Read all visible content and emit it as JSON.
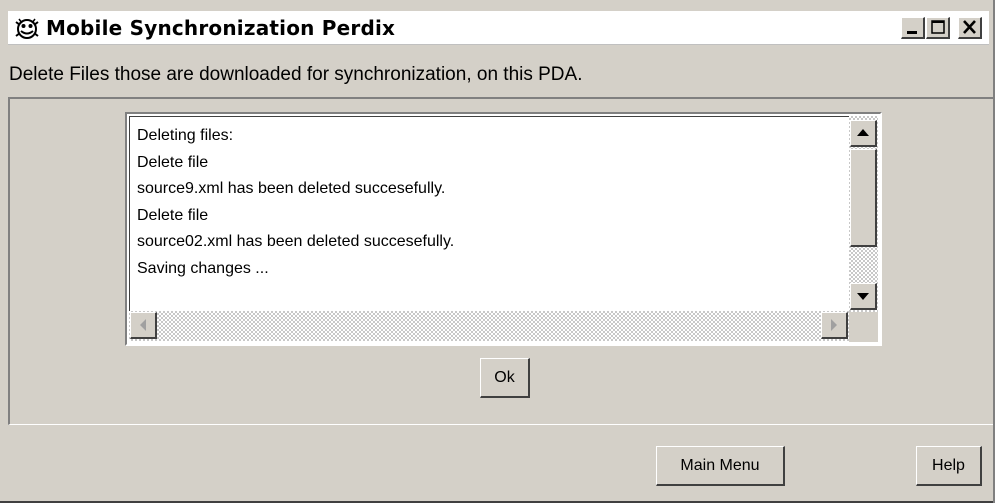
{
  "window": {
    "title": "Mobile Synchronization Perdix",
    "app_icon": "app-logo-icon",
    "controls": {
      "minimize_icon": "minimize-icon",
      "maximize_icon": "maximize-icon",
      "close_icon": "close-icon"
    }
  },
  "description": "Delete Files those are downloaded for synchronization, on this PDA.",
  "log": {
    "lines": [
      "Deleting files:",
      "Delete file",
      "source9.xml has been deleted succesefully.",
      "Delete file",
      "source02.xml has been deleted succesefully.",
      "Saving changes ..."
    ]
  },
  "scrollbars": {
    "up_icon": "scroll-up-arrow-icon",
    "down_icon": "scroll-down-arrow-icon",
    "left_icon": "scroll-left-arrow-icon",
    "right_icon": "scroll-right-arrow-icon"
  },
  "buttons": {
    "ok_label": "Ok",
    "main_menu_label": "Main Menu",
    "help_label": "Help"
  },
  "colors": {
    "window_bg": "#d4d0c8",
    "text": "#000000",
    "textarea_bg": "#ffffff"
  }
}
